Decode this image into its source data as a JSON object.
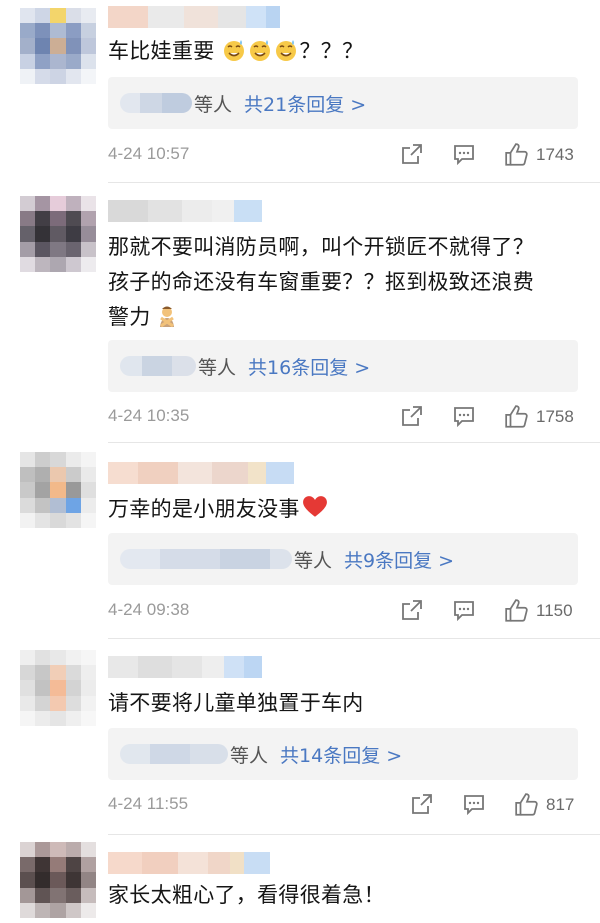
{
  "comments": [
    {
      "text": "车比娃重要",
      "text_suffix": "？？？",
      "emoji_count": 3,
      "reply_who": "等人",
      "reply_count": "共21条回复 >",
      "time": "4-24 10:57",
      "likes": "1743"
    },
    {
      "text_lines": [
        "那就不要叫消防员啊，叫个开锁匠不就得了？",
        "孩子的命还没有车窗重要？？抠到极致还浪费",
        "警力"
      ],
      "reply_who": "等人",
      "reply_count": "共16条回复 >",
      "time": "4-24 10:35",
      "likes": "1758"
    },
    {
      "text": "万幸的是小朋友没事",
      "reply_who": "等人",
      "reply_count": "共9条回复 >",
      "time": "4-24 09:38",
      "likes": "1150"
    },
    {
      "text": "请不要将儿童单独置于车内",
      "reply_who": "等人",
      "reply_count": "共14条回复 >",
      "time": "4-24 11:55",
      "likes": "817"
    },
    {
      "text": "家长太粗心了，看得很着急！"
    }
  ],
  "icons": {
    "forward": "share-icon",
    "comment": "comment-icon",
    "like": "thumbs-up-icon",
    "heart": "red-heart-emoji",
    "no_gesture": "no-gesture-emoji",
    "sweat": "sweat-smile-emoji"
  },
  "colors": {
    "link": "#4a78c2",
    "reply_bg": "#f3f3f3",
    "time": "#9a9a9a",
    "heart": "#e53935"
  }
}
